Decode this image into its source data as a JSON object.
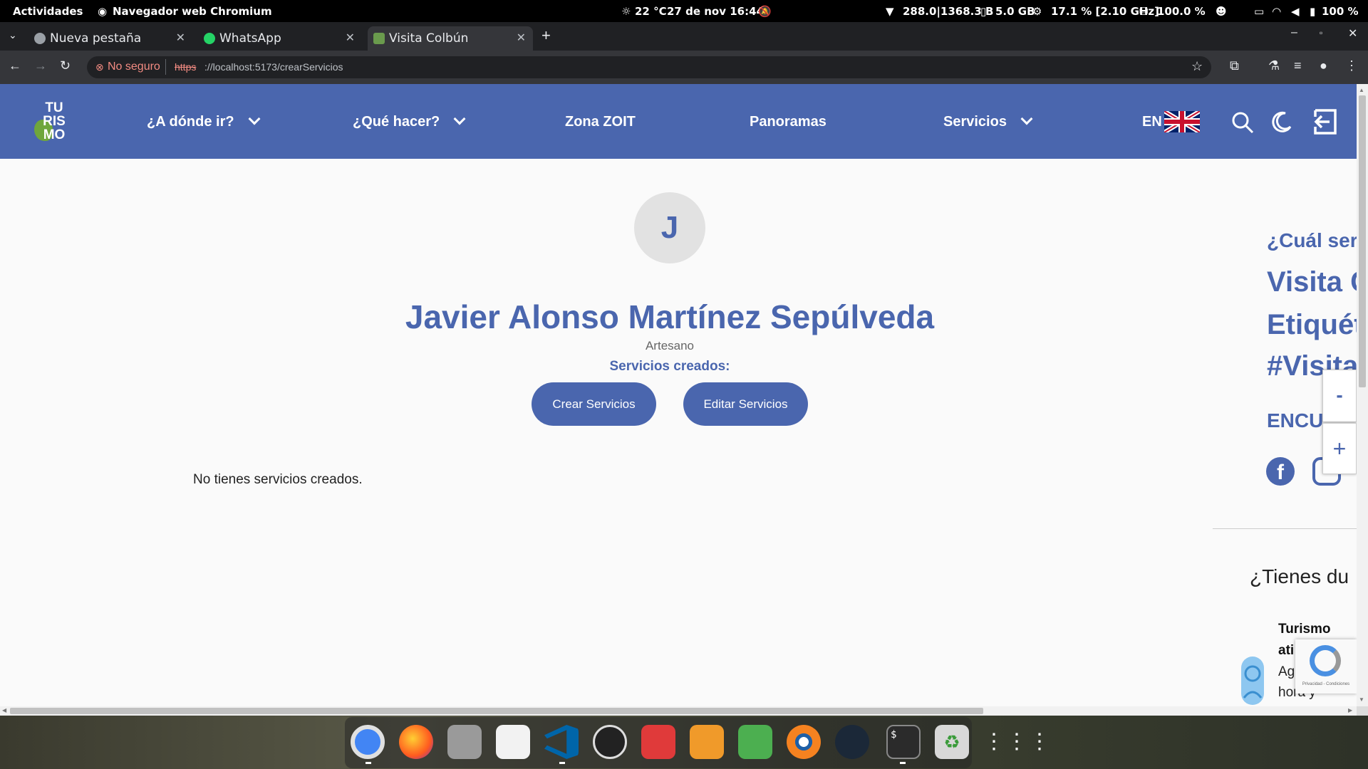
{
  "system": {
    "activities": "Actividades",
    "app_name": "Navegador web Chromium",
    "weather": "22 °C",
    "datetime": "27 de nov  16:44",
    "network": "288.0|1368.3 B",
    "memory": "5.0 GB",
    "cpu": "17.1 % [2.10 GHz]",
    "disk": "100.0 %",
    "battery": "100 %"
  },
  "browser": {
    "tabs": [
      {
        "label": "Nueva pestaña"
      },
      {
        "label": "WhatsApp"
      },
      {
        "label": "Visita Colbún"
      }
    ],
    "security_label": "No seguro",
    "url_scheme": "https",
    "url_rest": "://localhost:5173/crearServicios"
  },
  "nav": {
    "logo_lines": [
      "TU",
      "RIS",
      "MO"
    ],
    "items": [
      {
        "label": "¿A dónde ir?"
      },
      {
        "label": "¿Qué hacer?"
      },
      {
        "label": "Zona ZOIT"
      },
      {
        "label": "Panoramas"
      },
      {
        "label": "Servicios"
      }
    ],
    "lang": "EN"
  },
  "profile": {
    "initial": "J",
    "name": "Javier Alonso Martínez Sepúlveda",
    "role": "Artesano",
    "services_title": "Servicios creados:",
    "create_button": "Crear Servicios",
    "edit_button": "Editar Servicios",
    "empty_message": "No tienes servicios creados."
  },
  "side_panel": {
    "question": "¿Cuál ser",
    "line1": "Visita C",
    "line2": "Etiquét",
    "line3": "#Visita",
    "encu": "ENCU",
    "zoom_minus": "-",
    "zoom_plus": "+",
    "doubts": "¿Tienes du",
    "chat_title_1": "Turismo",
    "chat_title_2": "ati",
    "chat_text_1": "Ag",
    "chat_text_2": "hora y",
    "recaptcha": "Privacidad - Condiciones"
  },
  "colors": {
    "brand": "#4a66ae",
    "page_bg": "#fafafa"
  }
}
